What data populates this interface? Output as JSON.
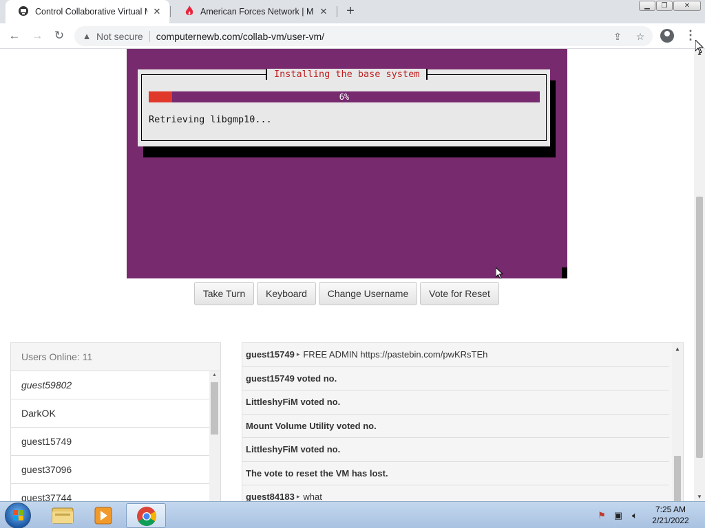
{
  "browser": {
    "tabs": [
      {
        "title": "Control Collaborative Virtual Ma",
        "icon": "collabvm-favicon-icon",
        "active": true
      },
      {
        "title": "American Forces Network | Milita",
        "icon": "afn-flame-icon",
        "active": false
      }
    ],
    "new_tab_label": "+",
    "address": {
      "security_label": "Not secure",
      "url": "computernewb.com/collab-vm/user-vm/"
    }
  },
  "vm": {
    "dialog_title": "Installing the base system",
    "progress_percent": 6,
    "progress_label": "6%",
    "status_text": "Retrieving libgmp10...",
    "colors": {
      "background": "#772a6e",
      "progress_fill": "#e0392b",
      "title": "#c02020"
    }
  },
  "controls": {
    "take_turn": "Take Turn",
    "keyboard": "Keyboard",
    "change_username": "Change Username",
    "vote_reset": "Vote for Reset"
  },
  "users": {
    "header": "Users Online: 11",
    "list": [
      "guest59802",
      "DarkOK",
      "guest15749",
      "guest37096",
      "guest37744"
    ]
  },
  "chat": {
    "messages": [
      {
        "user": "guest15749",
        "text": "FREE ADMIN https://pastebin.com/pwKRsTEh"
      },
      {
        "system": "guest15749 voted no."
      },
      {
        "system": "LittleshyFiM voted no."
      },
      {
        "system": "Mount Volume Utility voted no."
      },
      {
        "system": "LittleshyFiM voted no."
      },
      {
        "system": "The vote to reset the VM has lost."
      },
      {
        "user": "guest84183",
        "text": "what"
      }
    ],
    "separator": "▸"
  },
  "taskbar": {
    "clock_time": "7:25 AM",
    "clock_date": "2/21/2022",
    "pinned": [
      "explorer-folder-icon",
      "media-player-icon",
      "chrome-icon"
    ]
  }
}
